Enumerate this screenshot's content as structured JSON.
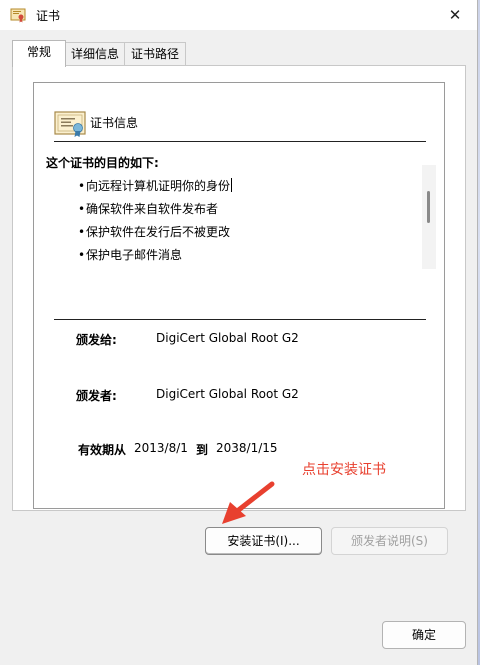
{
  "window": {
    "title": "证书",
    "close_glyph": "✕"
  },
  "tabs": [
    {
      "label": "常规",
      "active": true
    },
    {
      "label": "详细信息",
      "active": false
    },
    {
      "label": "证书路径",
      "active": false
    }
  ],
  "info": {
    "heading": "证书信息",
    "purpose_title": "这个证书的目的如下:",
    "purposes": [
      "向远程计算机证明你的身份",
      "确保软件来自软件发布者",
      "保护软件在发行后不被更改",
      "保护电子邮件消息"
    ],
    "bullet": "•",
    "issued_to_label": "颁发给:",
    "issued_to_value": "DigiCert Global Root G2",
    "issued_by_label": "颁发者:",
    "issued_by_value": "DigiCert Global Root G2",
    "valid_from_label": "有效期从",
    "valid_from": "2013/8/1",
    "valid_to_label": "到",
    "valid_to": "2038/1/15"
  },
  "annotation": {
    "text": "点击安装证书",
    "color": "#e8402f"
  },
  "buttons": {
    "install": "安装证书(I)...",
    "issuer_statement": "颁发者说明(S)",
    "ok": "确定"
  },
  "icons": {
    "title": "certificate-icon",
    "cert": "certificate-icon",
    "close": "close-icon"
  }
}
